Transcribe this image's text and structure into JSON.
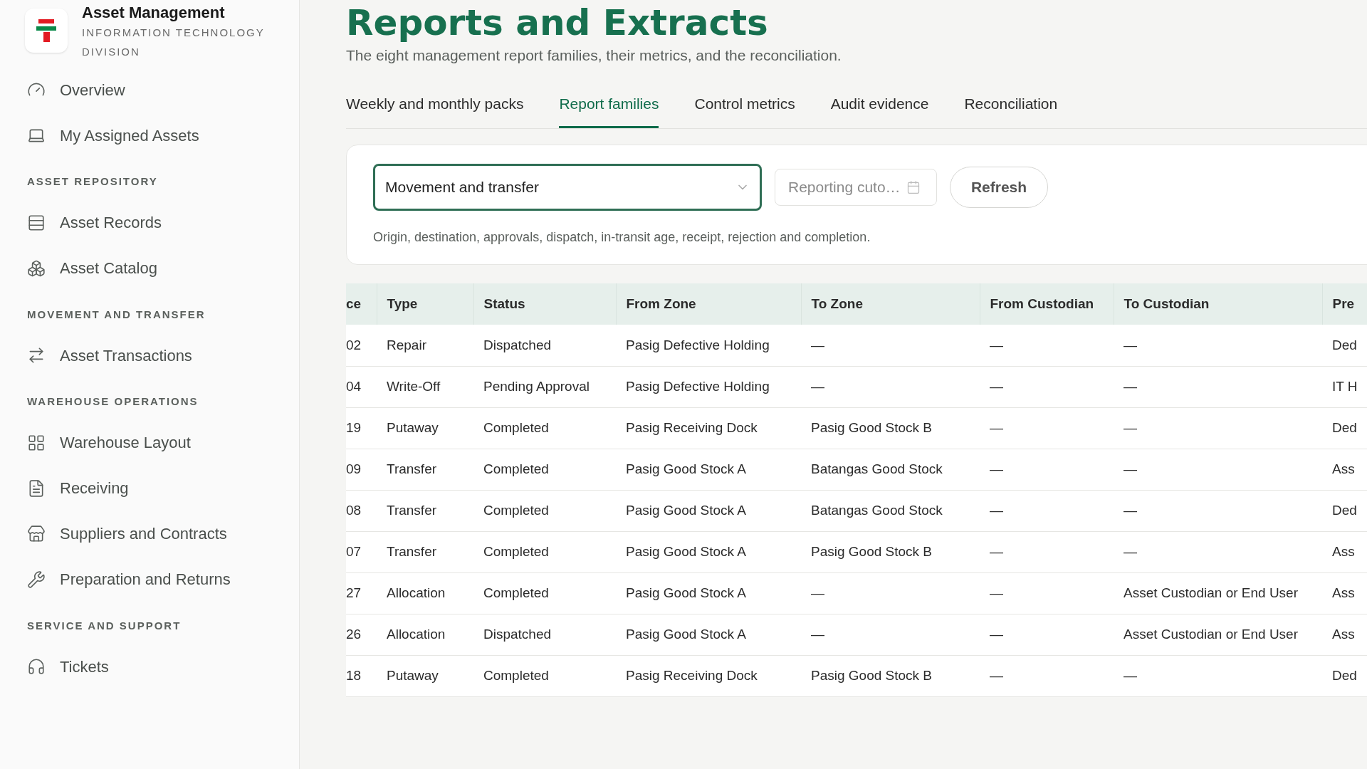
{
  "sidebar": {
    "app_title": "Asset Management",
    "org": "INFORMATION TECHNOLOGY DIVISION",
    "groups": [
      {
        "items": [
          {
            "label": "Overview",
            "selected": false
          },
          {
            "label": "My Assigned Assets",
            "selected": false
          }
        ]
      },
      {
        "heading": "ASSET REPOSITORY",
        "items": [
          {
            "label": "Asset Records",
            "selected": false
          },
          {
            "label": "Asset Catalog",
            "selected": false
          }
        ]
      },
      {
        "heading": "MOVEMENT AND TRANSFER",
        "items": [
          {
            "label": "Asset Transactions",
            "selected": false
          }
        ]
      },
      {
        "heading": "WAREHOUSE OPERATIONS",
        "items": [
          {
            "label": "Warehouse Layout",
            "selected": false
          },
          {
            "label": "Receiving",
            "selected": false
          },
          {
            "label": "Suppliers and Contracts",
            "selected": false
          },
          {
            "label": "Preparation and Returns",
            "selected": false
          }
        ]
      },
      {
        "heading": "SERVICE AND SUPPORT",
        "items": [
          {
            "label": "Tickets",
            "selected": false
          }
        ]
      }
    ]
  },
  "page": {
    "title": "Reports and Extracts",
    "subtitle": "The eight management report families, their metrics, and the reconciliation."
  },
  "tabs": [
    {
      "label": "Weekly and monthly packs",
      "selected": false
    },
    {
      "label": "Report families",
      "selected": true
    },
    {
      "label": "Control metrics",
      "selected": false
    },
    {
      "label": "Audit evidence",
      "selected": false
    },
    {
      "label": "Reconciliation",
      "selected": false
    }
  ],
  "filters": {
    "family": "Movement and transfer",
    "cutoff_placeholder": "Reporting cuto…",
    "refresh": "Refresh",
    "description": "Origin, destination, approvals, dispatch, in-transit age, receipt, rejection and completion."
  },
  "table": {
    "columns": [
      "ce",
      "Type",
      "Status",
      "From Zone",
      "To Zone",
      "From Custodian",
      "To Custodian",
      "Pre"
    ],
    "rows": [
      [
        "02",
        "Repair",
        "Dispatched",
        "Pasig Defective Holding",
        "—",
        "—",
        "—",
        "Ded"
      ],
      [
        "04",
        "Write-Off",
        "Pending Approval",
        "Pasig Defective Holding",
        "—",
        "—",
        "—",
        "IT H"
      ],
      [
        "19",
        "Putaway",
        "Completed",
        "Pasig Receiving Dock",
        "Pasig Good Stock B",
        "—",
        "—",
        "Ded"
      ],
      [
        "09",
        "Transfer",
        "Completed",
        "Pasig Good Stock A",
        "Batangas Good Stock",
        "—",
        "—",
        "Ass"
      ],
      [
        "08",
        "Transfer",
        "Completed",
        "Pasig Good Stock A",
        "Batangas Good Stock",
        "—",
        "—",
        "Ded"
      ],
      [
        "07",
        "Transfer",
        "Completed",
        "Pasig Good Stock A",
        "Pasig Good Stock B",
        "—",
        "—",
        "Ass"
      ],
      [
        "27",
        "Allocation",
        "Completed",
        "Pasig Good Stock A",
        "—",
        "—",
        "Asset Custodian or End User",
        "Ass"
      ],
      [
        "26",
        "Allocation",
        "Dispatched",
        "Pasig Good Stock A",
        "—",
        "—",
        "Asset Custodian or End User",
        "Ass"
      ],
      [
        "18",
        "Putaway",
        "Completed",
        "Pasig Receiving Dock",
        "Pasig Good Stock B",
        "—",
        "—",
        "Ded"
      ]
    ]
  }
}
